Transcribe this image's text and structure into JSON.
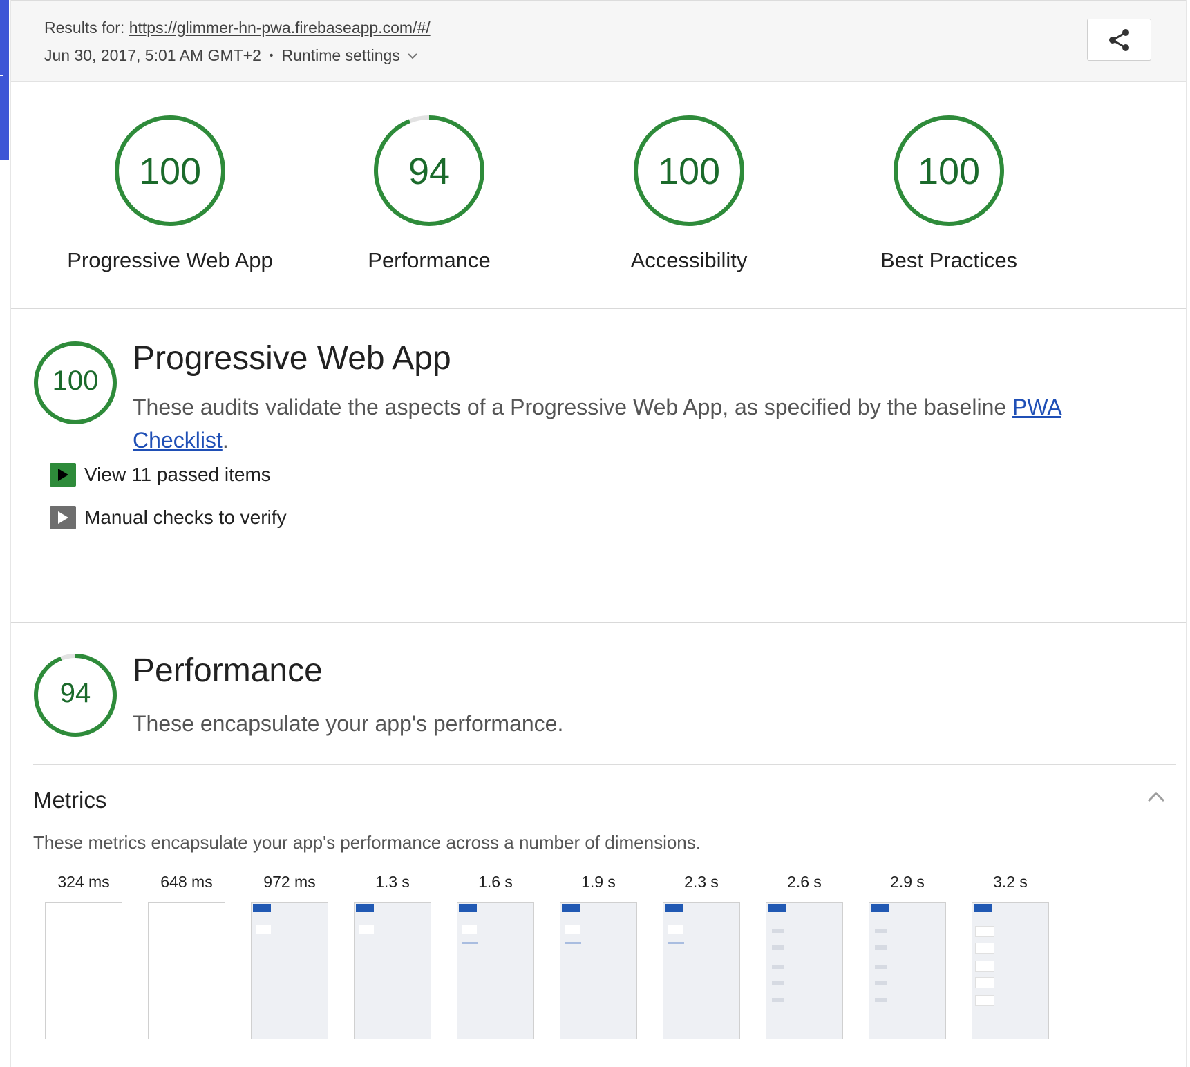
{
  "header": {
    "results_prefix": "Results for:",
    "url": "https://glimmer-hn-pwa.firebaseapp.com/#/",
    "date": "Jun 30, 2017, 5:01 AM GMT+2",
    "separator": "•",
    "runtime_settings": "Runtime settings"
  },
  "colors": {
    "pass_green": "#2e8b3a",
    "score_text": "#1b6a2b",
    "link_blue": "#1f4fb6",
    "accent_blue": "#3d55d6"
  },
  "gauges": [
    {
      "score": 100,
      "label": "Progressive Web App"
    },
    {
      "score": 94,
      "label": "Performance"
    },
    {
      "score": 100,
      "label": "Accessibility"
    },
    {
      "score": 100,
      "label": "Best Practices"
    }
  ],
  "pwa_section": {
    "score": 100,
    "title": "Progressive Web App",
    "description": "These audits validate the aspects of a Progressive Web App, as specified by the baseline",
    "link_text_1": "PWA",
    "link_text_2": "Checklist",
    "period": ".",
    "passed_toggle": "View 11 passed items",
    "manual_toggle": "Manual checks to verify"
  },
  "perf_section": {
    "score": 94,
    "title": "Performance",
    "description": "These encapsulate your app's performance.",
    "metrics_title": "Metrics",
    "metrics_description": "These metrics encapsulate your app's performance across a number of dimensions."
  },
  "filmstrip": [
    {
      "time": "324 ms",
      "state": "blank"
    },
    {
      "time": "648 ms",
      "state": "blank"
    },
    {
      "time": "972 ms",
      "state": "header"
    },
    {
      "time": "1.3 s",
      "state": "header"
    },
    {
      "time": "1.6 s",
      "state": "link"
    },
    {
      "time": "1.9 s",
      "state": "link"
    },
    {
      "time": "2.3 s",
      "state": "link"
    },
    {
      "time": "2.6 s",
      "state": "list-faint"
    },
    {
      "time": "2.9 s",
      "state": "list-faint"
    },
    {
      "time": "3.2 s",
      "state": "list"
    }
  ],
  "icons": {
    "share": "share-icon",
    "runtime_chevron": "chevron-down-icon",
    "collapse": "chevron-up-icon",
    "play": "play-icon"
  }
}
